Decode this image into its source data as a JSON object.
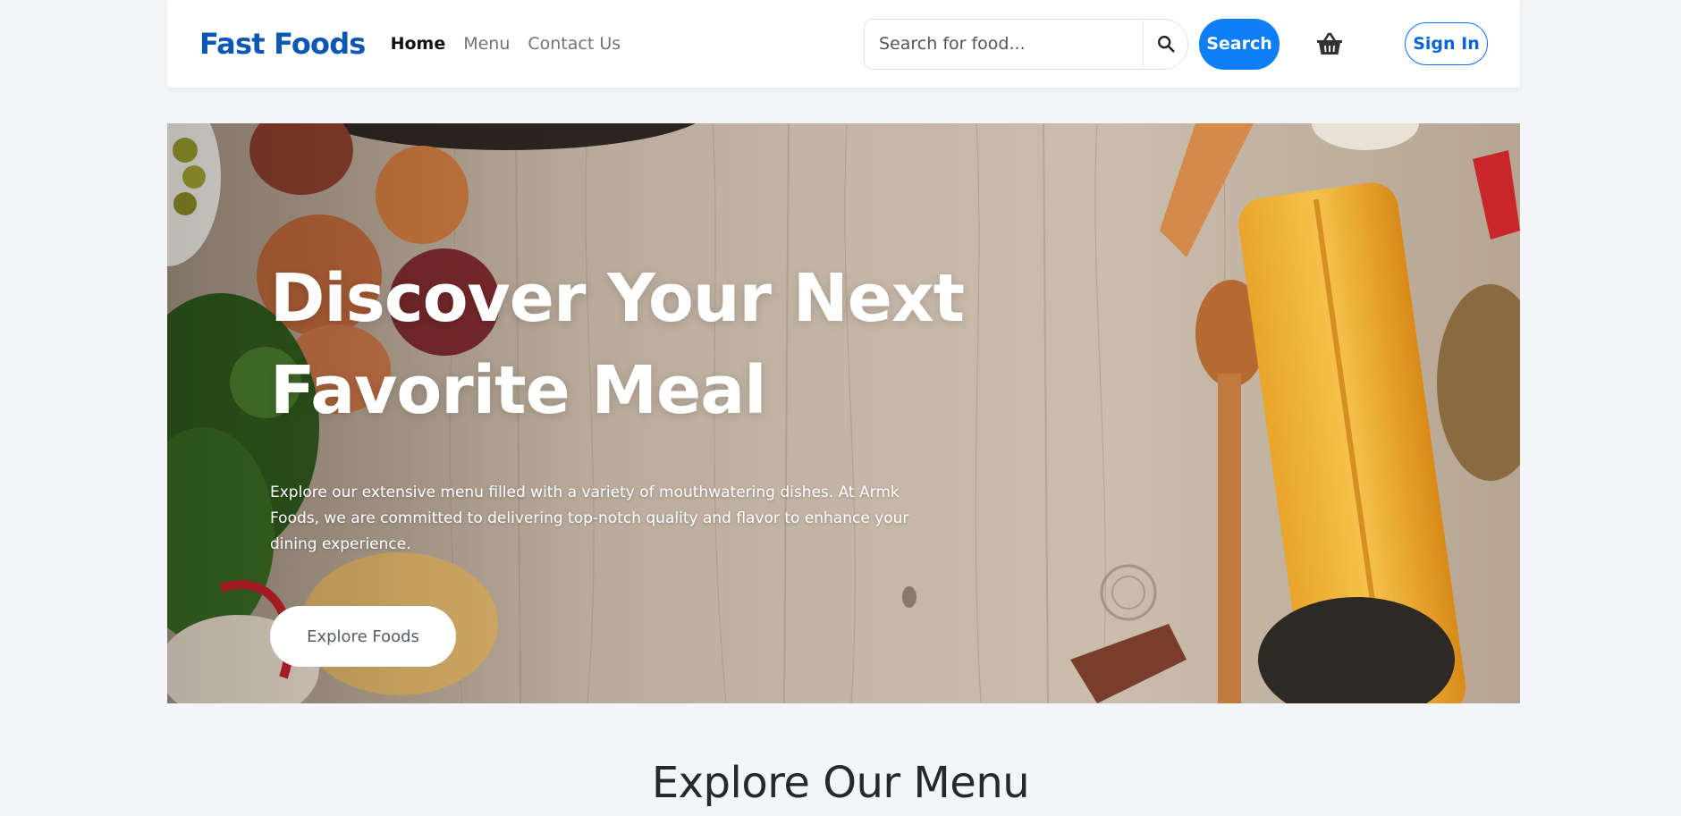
{
  "navbar": {
    "brand": "Fast Foods",
    "links": [
      {
        "label": "Home",
        "active": true
      },
      {
        "label": "Menu",
        "active": false
      },
      {
        "label": "Contact Us",
        "active": false
      }
    ],
    "search": {
      "placeholder": "Search for food...",
      "value": "",
      "icon": "search-icon",
      "button_label": "Search"
    },
    "cart_icon": "basket-icon",
    "signin_label": "Sign In"
  },
  "hero": {
    "title_line1": "Discover Your Next",
    "title_line2": "Favorite Meal",
    "text": "Explore our extensive menu filled with a variety of mouthwatering dishes. At Armk Foods, we are committed to delivering top-notch quality and flavor to enhance your dining experience.",
    "cta_label": "Explore Foods"
  },
  "section": {
    "title": "Explore Our Menu"
  },
  "colors": {
    "brand": "#0b57b5",
    "primary": "#0d7ef5",
    "page_bg": "#f3f6f9"
  }
}
